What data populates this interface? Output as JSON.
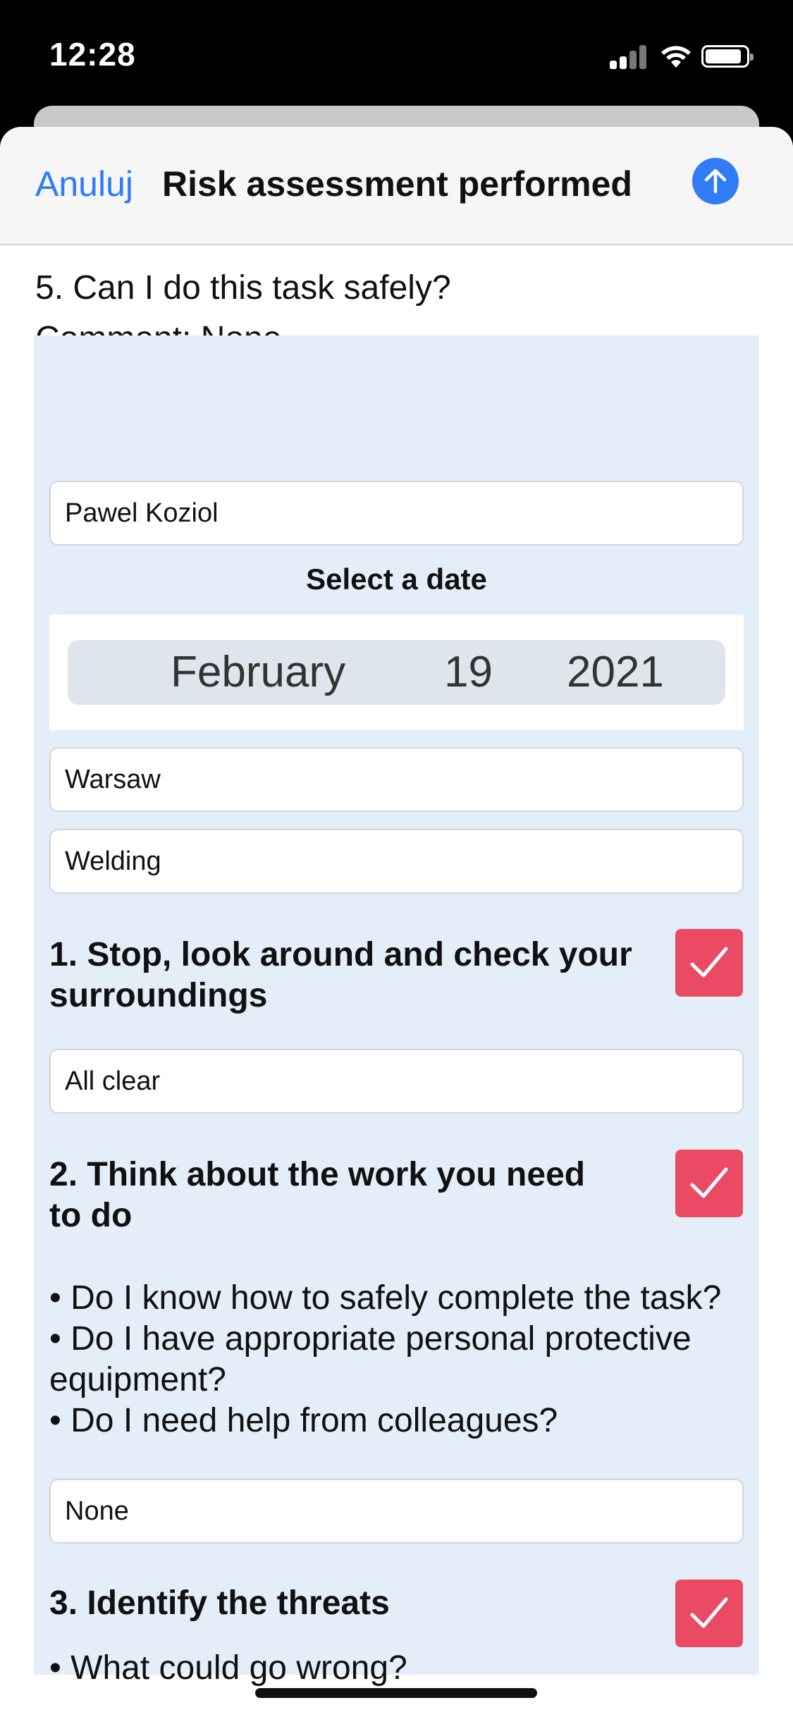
{
  "status_bar": {
    "time": "12:28"
  },
  "nav": {
    "cancel_label": "Anuluj",
    "title": "Risk assessment performed",
    "send_icon": "arrow-up-circle-icon",
    "accent_color": "#2f7cf6"
  },
  "previous": {
    "question": "5. Can I do this task safely?",
    "comment": "Comment: None"
  },
  "form": {
    "name_value": "Pawel Koziol",
    "date_label": "Select a date",
    "date": {
      "month": "February",
      "day": "19",
      "year": "2021"
    },
    "location_value": "Warsaw",
    "task_value": "Welding",
    "sections": [
      {
        "title": "1. Stop, look around and check your surroundings",
        "checked": true,
        "answer": "All clear"
      },
      {
        "title": "2. Think about the work you need to do",
        "checked": true,
        "bullets": [
          "• Do I know how to safely complete the task?",
          "• Do I have appropriate personal protective equipment?",
          "• Do I need help from colleagues?"
        ],
        "answer": "None"
      },
      {
        "title": "3. Identify the threats",
        "checked": true,
        "bullets": [
          "• What could go wrong?"
        ]
      }
    ],
    "check_color": "#ea4a63",
    "panel_color": "#e4eef9"
  }
}
